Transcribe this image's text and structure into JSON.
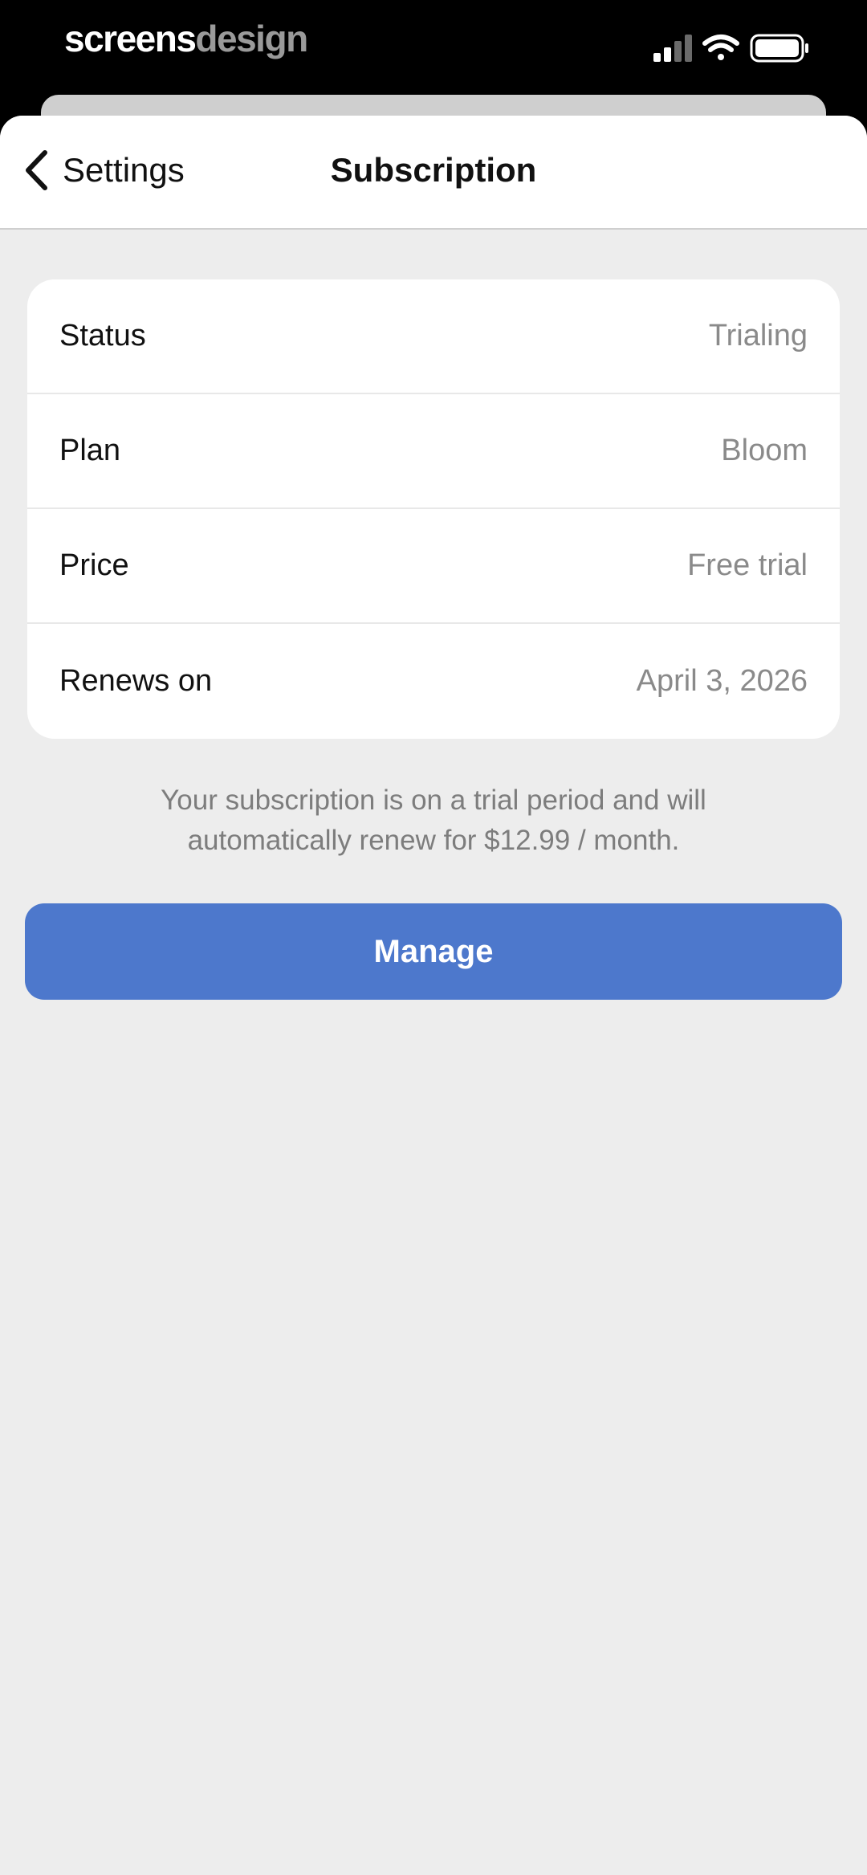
{
  "status_bar": {
    "brand_part1": "screens",
    "brand_part2": "design",
    "icons": [
      "cellular-signal-icon",
      "wifi-icon",
      "battery-icon"
    ]
  },
  "nav": {
    "back_label": "Settings",
    "title": "Subscription"
  },
  "details": [
    {
      "label": "Status",
      "value": "Trialing"
    },
    {
      "label": "Plan",
      "value": "Bloom"
    },
    {
      "label": "Price",
      "value": "Free trial"
    },
    {
      "label": "Renews on",
      "value": "April 3, 2026"
    }
  ],
  "note": "Your subscription is on a trial period and will automatically renew for $12.99 / month.",
  "manage_button": "Manage",
  "colors": {
    "accent": "#4d78cc",
    "background": "#ededed",
    "card": "#ffffff",
    "secondary_text": "#8a8a8a"
  }
}
